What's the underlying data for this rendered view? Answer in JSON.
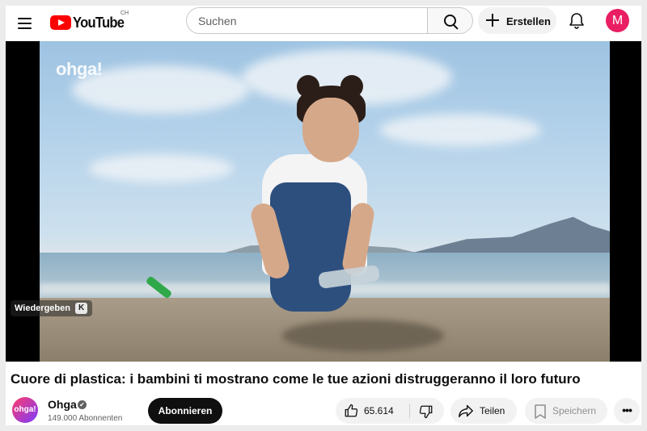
{
  "header": {
    "logo_text": "YouTube",
    "region_code": "CH",
    "search_placeholder": "Suchen",
    "create_label": "Erstellen",
    "account_initial": "M"
  },
  "player": {
    "watermark": "ohga!",
    "watch_chip_label": "Wiedergeben",
    "watch_chip_key": "K"
  },
  "video": {
    "title": "Cuore di plastica: i bambini ti mostrano come le tue azioni distruggeranno il loro futuro"
  },
  "channel": {
    "avatar_text": "ohga!",
    "name": "Ohga",
    "verified_mark": "✔",
    "subscribers": "149.000 Abonnenten",
    "subscribe_label": "Abonnieren"
  },
  "actions": {
    "like_count": "65.614",
    "share_label": "Teilen",
    "save_label": "Speichern",
    "more_label": "•••"
  },
  "icons": {
    "menu": "hamburger-icon",
    "search": "search-icon",
    "create": "plus-icon",
    "notifications": "bell-icon",
    "like": "thumbs-up-icon",
    "dislike": "thumbs-down-icon",
    "share": "share-arrow-icon",
    "save": "bookmark-icon",
    "more": "more-horizontal-icon"
  },
  "colors": {
    "brand_red": "#ff0000",
    "subscribe_bg": "#0f0f0f",
    "account_avatar": "#e91e63"
  }
}
